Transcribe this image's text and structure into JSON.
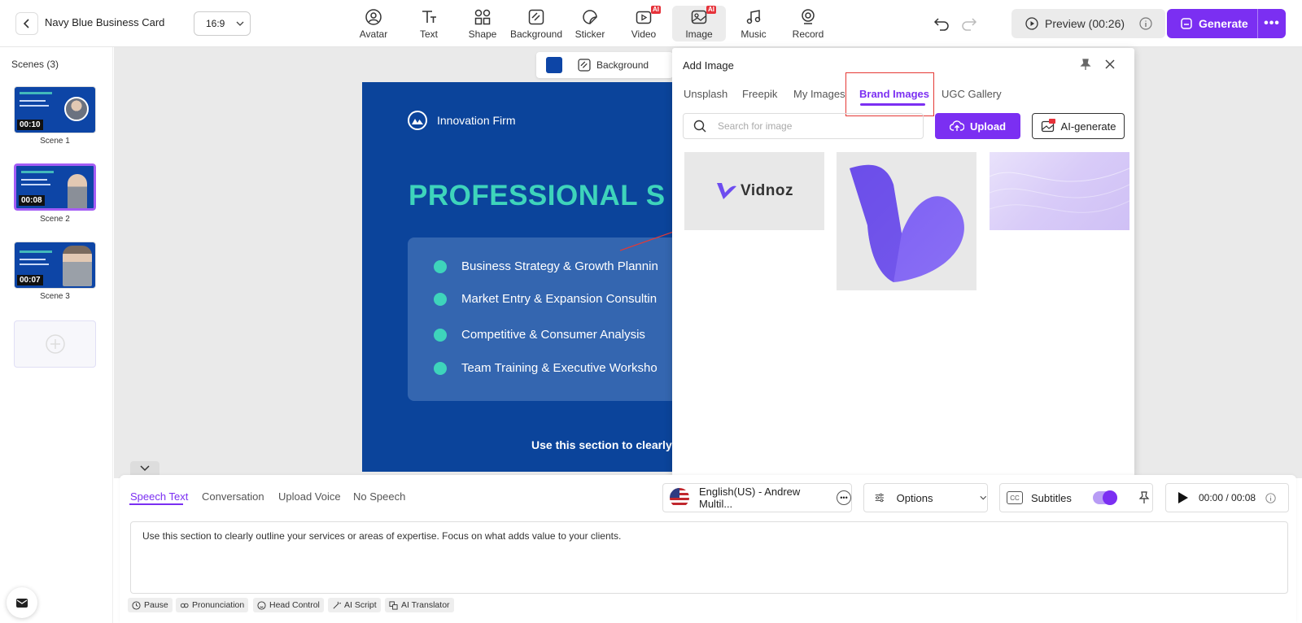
{
  "header": {
    "project_title": "Navy Blue Business Card",
    "aspect_ratio": "16:9",
    "tools": [
      {
        "label": "Avatar",
        "icon": "avatar-icon",
        "ai": false
      },
      {
        "label": "Text",
        "icon": "text-icon",
        "ai": false
      },
      {
        "label": "Shape",
        "icon": "shape-icon",
        "ai": false
      },
      {
        "label": "Background",
        "icon": "background-icon",
        "ai": false
      },
      {
        "label": "Sticker",
        "icon": "sticker-icon",
        "ai": false
      },
      {
        "label": "Video",
        "icon": "video-icon",
        "ai": true
      },
      {
        "label": "Image",
        "icon": "image-icon",
        "ai": true,
        "active": true
      },
      {
        "label": "Music",
        "icon": "music-icon",
        "ai": false
      },
      {
        "label": "Record",
        "icon": "record-icon",
        "ai": false
      }
    ],
    "ai_badge": "AI",
    "preview_label": "Preview (00:26)",
    "generate_label": "Generate",
    "more_label": "•••"
  },
  "sidebar": {
    "title": "Scenes (3)",
    "scenes": [
      {
        "label": "Scene 1",
        "duration": "00:10",
        "selected": false
      },
      {
        "label": "Scene 2",
        "duration": "00:08",
        "selected": true
      },
      {
        "label": "Scene 3",
        "duration": "00:07",
        "selected": false
      }
    ]
  },
  "canvas": {
    "toolbar": {
      "background_label": "Background",
      "swatch_color": "#0d45a6"
    },
    "slide": {
      "brand": "Innovation Firm",
      "heading": "PROFESSIONAL S",
      "services": [
        "Business Strategy & Growth Plannin",
        "Market Entry & Expansion Consultin",
        "Competitive & Consumer Analysis",
        "Team Training & Executive Worksho"
      ],
      "caption": "Use this section to clearly o",
      "bg_color": "#0b449b",
      "accent_color": "#3ed4bb"
    }
  },
  "add_image_panel": {
    "title": "Add Image",
    "tabs": [
      "Unsplash",
      "Freepik",
      "My Images",
      "Brand Images",
      "UGC Gallery"
    ],
    "active_tab": "Brand Images",
    "search_placeholder": "Search for image",
    "upload_label": "Upload",
    "ai_generate_label": "AI-generate",
    "images": [
      {
        "name": "vidnoz-wordmark",
        "text": "Vidnoz"
      },
      {
        "name": "vidnoz-v-logo"
      },
      {
        "name": "lavender-wave-background"
      }
    ]
  },
  "speech": {
    "tabs": [
      "Speech Text",
      "Conversation",
      "Upload Voice",
      "No Speech"
    ],
    "active_tab": "Speech Text",
    "voice": "English(US) - Andrew Multil...",
    "options_label": "Options",
    "subtitles_label": "Subtitles",
    "subtitles_on": true,
    "cc_label": "CC",
    "time": "00:00 / 00:08",
    "text": "Use this section to clearly outline your services or areas of expertise. Focus on what adds value to your clients.",
    "chips": [
      "Pause",
      "Pronunciation",
      "Head Control",
      "AI Script",
      "AI Translator"
    ]
  },
  "colors": {
    "accent": "#7b2ff2",
    "highlight_box": "#e53935",
    "annotation_arrow": "#e53935"
  }
}
